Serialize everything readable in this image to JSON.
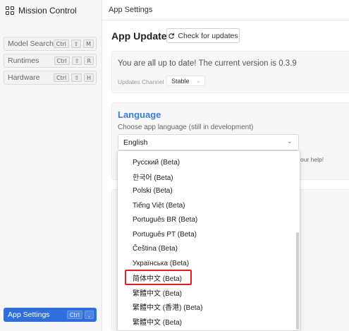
{
  "app": {
    "title": "Mission Control"
  },
  "sidebar": {
    "items": [
      {
        "label": "Model Search",
        "keys": [
          "Ctrl",
          "⇧",
          "M"
        ]
      },
      {
        "label": "Runtimes",
        "keys": [
          "Ctrl",
          "⇧",
          "R"
        ]
      },
      {
        "label": "Hardware",
        "keys": [
          "Ctrl",
          "⇧",
          "H"
        ]
      }
    ],
    "settings": {
      "label": "App Settings",
      "keys": [
        "Ctrl",
        ","
      ]
    }
  },
  "main": {
    "breadcrumb": "App Settings",
    "update": {
      "title": "App Update",
      "check_button": "Check for updates",
      "status": "You are all up to date! The current version is 0.3.9",
      "channel_label": "Updates Channel",
      "channel_value": "Stable"
    },
    "language": {
      "title": "Language",
      "description": "Choose app language (still in development)",
      "selected": "English",
      "help_fragment": "our help!"
    }
  },
  "dropdown": {
    "options": [
      "Русский (Beta)",
      "한국어 (Beta)",
      "Polski (Beta)",
      "Tiếng Việt (Beta)",
      "Português BR (Beta)",
      "Português PT (Beta)",
      "Čeština (Beta)",
      "Українська (Beta)",
      "简体中文 (Beta)",
      "繁體中文 (Beta)",
      "繁體中文 (香港) (Beta)",
      "繁體中文 (Beta)"
    ],
    "highlighted_index": 8
  },
  "colors": {
    "accent": "#2f6fdc",
    "language_title": "#3a7bd5",
    "highlight_border": "#e02020"
  },
  "icons": {
    "brand": "grid-icon",
    "check_updates": "refresh-icon",
    "select_chevron": "chevron-down-icon"
  }
}
